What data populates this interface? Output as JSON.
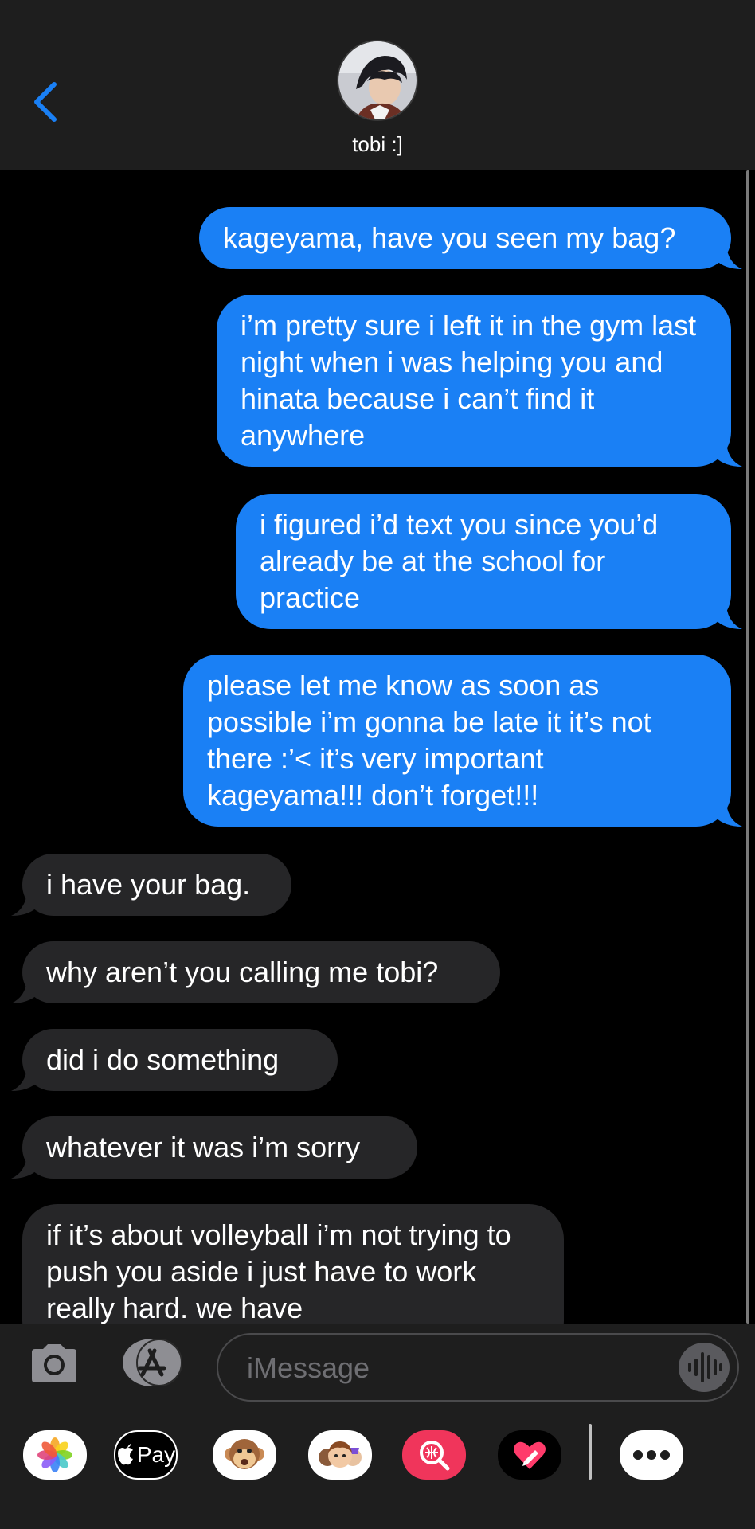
{
  "header": {
    "contact_name": "tobi :]",
    "back_icon": "chevron-left-icon",
    "accent_color": "#1a80f5"
  },
  "messages": [
    {
      "side": "sent",
      "text": "kageyama, have you seen my bag?"
    },
    {
      "side": "sent",
      "text": "i’m pretty sure i left it in the gym last night when i was helping you and hinata because i can’t find it anywhere"
    },
    {
      "side": "sent",
      "text": "i figured i’d text you since you’d already be at the school for practice"
    },
    {
      "side": "sent",
      "text": "please let me know as soon as possible i’m gonna be late it it’s not there :’< it’s very important kageyama!!! don’t forget!!!"
    },
    {
      "side": "received",
      "text": "i have your bag."
    },
    {
      "side": "received",
      "text": "why aren’t you calling me tobi?"
    },
    {
      "side": "received",
      "text": "did i do something"
    },
    {
      "side": "received",
      "text": "whatever it was i’m sorry"
    },
    {
      "side": "received",
      "text": "if it’s about volleyball i’m not trying to push you aside i just have to work really hard. we have"
    }
  ],
  "input": {
    "placeholder": "iMessage",
    "camera_icon": "camera-icon",
    "apps_icon": "app-store-icon",
    "audio_icon": "audio-waveform-icon"
  },
  "drawer": {
    "apps": [
      "photos-icon",
      "apple-pay-icon",
      "animoji-icon",
      "memoji-icon",
      "image-search-icon",
      "digital-touch-icon",
      "more-icon"
    ],
    "apple_pay_label": "Pay"
  },
  "colors": {
    "sent_bubble": "#1a80f5",
    "received_bubble": "#262628",
    "background": "#000000",
    "chrome": "#1e1e1e"
  }
}
